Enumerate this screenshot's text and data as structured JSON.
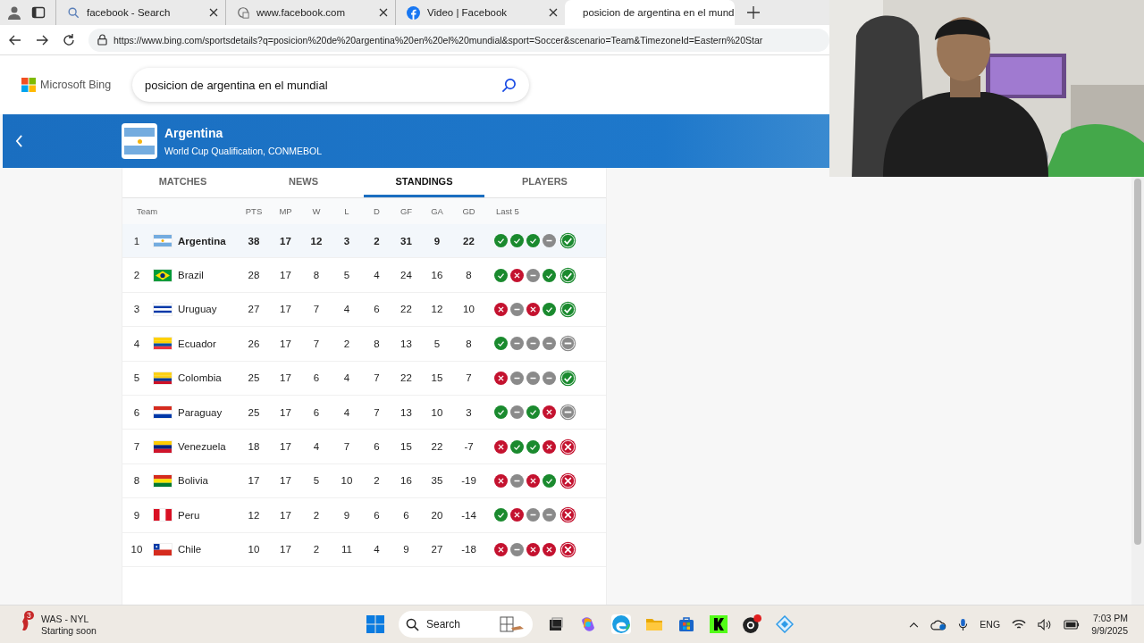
{
  "browser": {
    "tabs": [
      {
        "title": "facebook - Search",
        "selected": false
      },
      {
        "title": "www.facebook.com",
        "selected": false
      },
      {
        "title": "Video | Facebook",
        "selected": false
      },
      {
        "title": "posicion de argentina en el mund",
        "selected": true
      }
    ],
    "url": "https://www.bing.com/sportsdetails?q=posicion%20de%20argentina%20en%20el%20mundial&sport=Soccer&scenario=Team&TimezoneId=Eastern%20Star"
  },
  "header": {
    "logo": "Microsoft Bing",
    "search_value": "posicion de argentina en el mundial"
  },
  "banner": {
    "team": "Argentina",
    "competition": "World Cup Qualification, CONMEBOL"
  },
  "tabs": [
    {
      "label": "MATCHES",
      "selected": false
    },
    {
      "label": "NEWS",
      "selected": false
    },
    {
      "label": "STANDINGS",
      "selected": true
    },
    {
      "label": "PLAYERS",
      "selected": false
    }
  ],
  "table": {
    "columns": [
      "Team",
      "PTS",
      "MP",
      "W",
      "L",
      "D",
      "GF",
      "GA",
      "GD",
      "Last 5"
    ],
    "rows": [
      {
        "rank": "1",
        "team": "Argentina",
        "highlighted": true,
        "stats": [
          "38",
          "17",
          "12",
          "3",
          "2",
          "31",
          "9",
          "22"
        ],
        "last5": [
          {
            "kind": "win"
          },
          {
            "kind": "win"
          },
          {
            "kind": "win"
          },
          {
            "kind": "draw"
          },
          {
            "kind": "win"
          }
        ]
      },
      {
        "rank": "2",
        "team": "Brazil",
        "highlighted": false,
        "stats": [
          "28",
          "17",
          "8",
          "5",
          "4",
          "24",
          "16",
          "8"
        ],
        "last5": [
          {
            "kind": "win"
          },
          {
            "kind": "loss"
          },
          {
            "kind": "draw"
          },
          {
            "kind": "win"
          },
          {
            "kind": "win"
          }
        ]
      },
      {
        "rank": "3",
        "team": "Uruguay",
        "highlighted": false,
        "stats": [
          "27",
          "17",
          "7",
          "4",
          "6",
          "22",
          "12",
          "10"
        ],
        "last5": [
          {
            "kind": "loss"
          },
          {
            "kind": "draw"
          },
          {
            "kind": "loss"
          },
          {
            "kind": "win"
          },
          {
            "kind": "win"
          }
        ]
      },
      {
        "rank": "4",
        "team": "Ecuador",
        "highlighted": false,
        "stats": [
          "26",
          "17",
          "7",
          "2",
          "8",
          "13",
          "5",
          "8"
        ],
        "last5": [
          {
            "kind": "win"
          },
          {
            "kind": "draw"
          },
          {
            "kind": "draw"
          },
          {
            "kind": "draw"
          },
          {
            "kind": "draw"
          }
        ]
      },
      {
        "rank": "5",
        "team": "Colombia",
        "highlighted": false,
        "stats": [
          "25",
          "17",
          "6",
          "4",
          "7",
          "22",
          "15",
          "7"
        ],
        "last5": [
          {
            "kind": "loss"
          },
          {
            "kind": "draw"
          },
          {
            "kind": "draw"
          },
          {
            "kind": "draw"
          },
          {
            "kind": "win"
          }
        ]
      },
      {
        "rank": "6",
        "team": "Paraguay",
        "highlighted": false,
        "stats": [
          "25",
          "17",
          "6",
          "4",
          "7",
          "13",
          "10",
          "3"
        ],
        "last5": [
          {
            "kind": "win"
          },
          {
            "kind": "draw"
          },
          {
            "kind": "win"
          },
          {
            "kind": "loss"
          },
          {
            "kind": "draw"
          }
        ]
      },
      {
        "rank": "7",
        "team": "Venezuela",
        "highlighted": false,
        "stats": [
          "18",
          "17",
          "4",
          "7",
          "6",
          "15",
          "22",
          "-7"
        ],
        "last5": [
          {
            "kind": "loss"
          },
          {
            "kind": "win"
          },
          {
            "kind": "win"
          },
          {
            "kind": "loss"
          },
          {
            "kind": "loss"
          }
        ]
      },
      {
        "rank": "8",
        "team": "Bolivia",
        "highlighted": false,
        "stats": [
          "17",
          "17",
          "5",
          "10",
          "2",
          "16",
          "35",
          "-19"
        ],
        "last5": [
          {
            "kind": "loss"
          },
          {
            "kind": "draw"
          },
          {
            "kind": "loss"
          },
          {
            "kind": "win"
          },
          {
            "kind": "loss"
          }
        ]
      },
      {
        "rank": "9",
        "team": "Peru",
        "highlighted": false,
        "stats": [
          "12",
          "17",
          "2",
          "9",
          "6",
          "6",
          "20",
          "-14"
        ],
        "last5": [
          {
            "kind": "win"
          },
          {
            "kind": "loss"
          },
          {
            "kind": "draw"
          },
          {
            "kind": "draw"
          },
          {
            "kind": "loss"
          }
        ]
      },
      {
        "rank": "10",
        "team": "Chile",
        "highlighted": false,
        "stats": [
          "10",
          "17",
          "2",
          "11",
          "4",
          "9",
          "27",
          "-18"
        ],
        "last5": [
          {
            "kind": "loss"
          },
          {
            "kind": "draw"
          },
          {
            "kind": "loss"
          },
          {
            "kind": "loss"
          },
          {
            "kind": "loss"
          }
        ]
      }
    ]
  },
  "taskbar": {
    "weather_badge": "3",
    "weather_title": "WAS - NYL",
    "weather_subtitle": "Starting soon",
    "search_placeholder": "Search",
    "language": "ENG",
    "time": "7:03 PM",
    "date": "9/9/2025"
  }
}
